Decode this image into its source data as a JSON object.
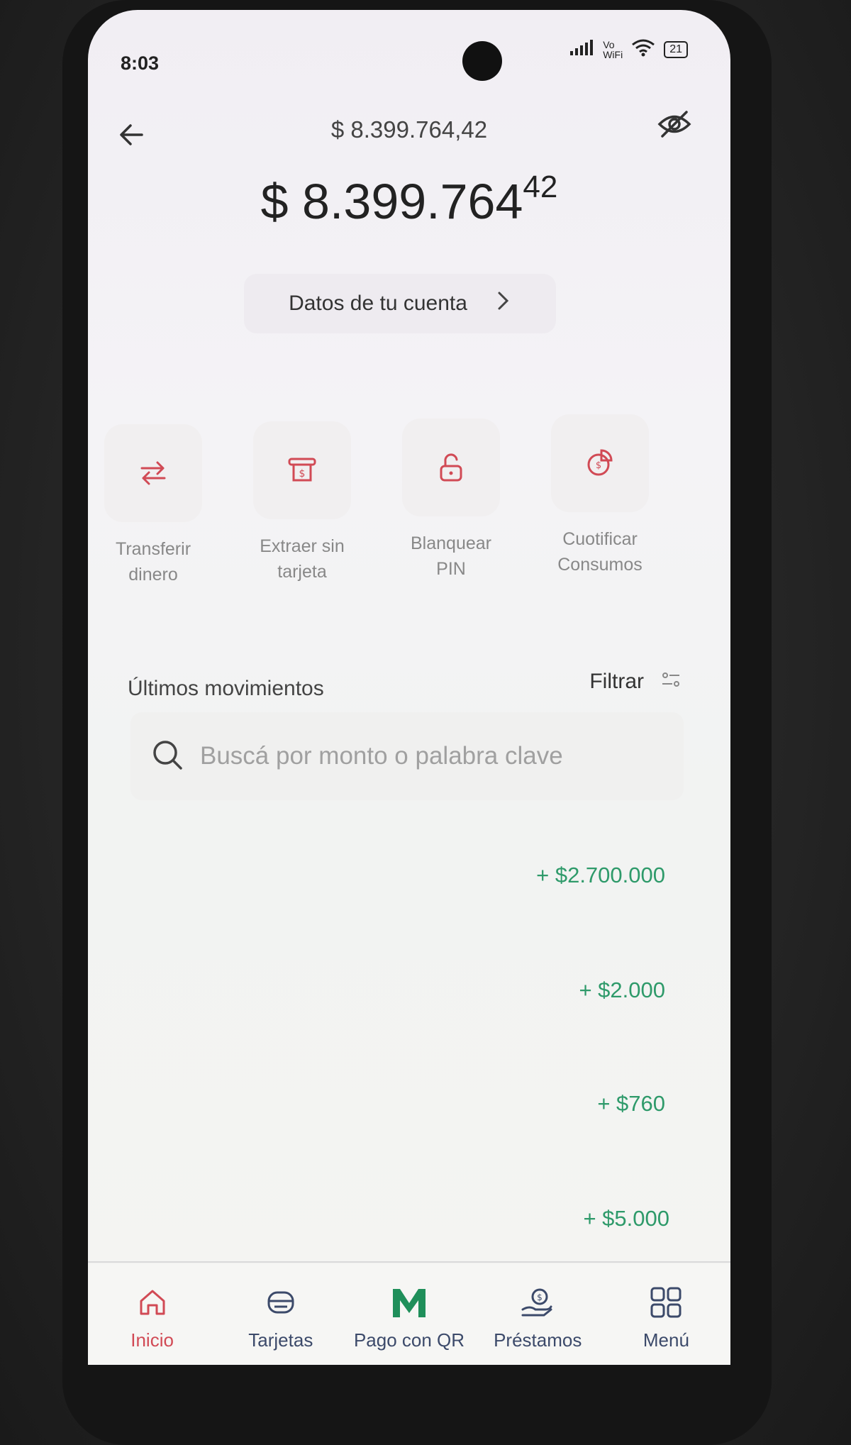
{
  "status": {
    "time": "8:03",
    "network": "Vo WiFi",
    "battery": "21"
  },
  "header": {
    "amount": "$ 8.399.764,42"
  },
  "balance": {
    "integer": "$ 8.399.764",
    "cents": "42"
  },
  "account_button": {
    "label": "Datos de tu cuenta"
  },
  "actions": [
    {
      "line1": "Transferir",
      "line2": "dinero",
      "icon": "transfer-icon"
    },
    {
      "line1": "Extraer sin",
      "line2": "tarjeta",
      "icon": "cash-withdraw-icon"
    },
    {
      "line1": "Blanquear",
      "line2": "PIN",
      "icon": "unlock-icon"
    },
    {
      "line1": "Cuotificar",
      "line2": "Consumos",
      "icon": "installments-icon"
    }
  ],
  "movements": {
    "title": "Últimos movimientos",
    "filter_label": "Filtrar",
    "search_placeholder": "Buscá por monto o palabra clave",
    "items": [
      {
        "amount": "+ $2.700.000"
      },
      {
        "amount": "+ $2.000"
      },
      {
        "amount": "+ $760"
      },
      {
        "amount": "+ $5.000"
      }
    ]
  },
  "nav": [
    {
      "label": "Inicio",
      "icon": "home-icon",
      "active": true
    },
    {
      "label": "Tarjetas",
      "icon": "cards-icon"
    },
    {
      "label": "Pago con QR",
      "icon": "m-logo-icon"
    },
    {
      "label": "Préstamos",
      "icon": "loan-icon"
    },
    {
      "label": "Menú",
      "icon": "grid-icon"
    }
  ],
  "colors": {
    "accent": "#d14a55",
    "positive": "#2e9a6a",
    "brand_m": "#1f8f5a"
  }
}
